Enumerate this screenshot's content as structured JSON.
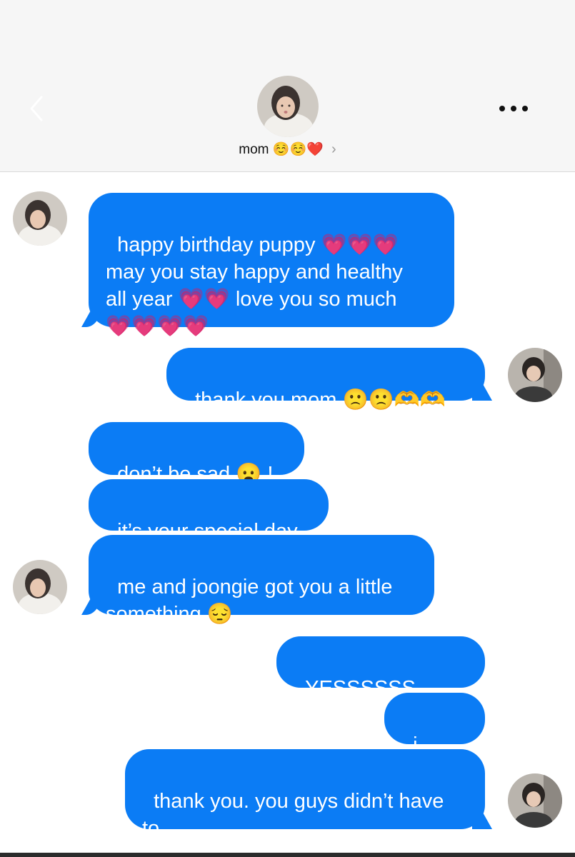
{
  "header": {
    "contact_name": "mom",
    "name_emojis": "☺️☺️❤️",
    "chevron": "›",
    "more": "•••"
  },
  "messages": [
    {
      "side": "left",
      "text": "happy birthday puppy 💗💗💗\nmay you stay happy and healthy\nall year 💗💗 love you so much\n💗💗💗💗"
    },
    {
      "side": "right",
      "text": "thank you mom 🙁🙁🫶🫶"
    },
    {
      "side": "left",
      "text": "don’t be sad 😦 !"
    },
    {
      "side": "left",
      "text": "it’s your special day"
    },
    {
      "side": "left",
      "text": "me and joongie got you a little\nsomething 😔"
    },
    {
      "side": "right",
      "text": "YESSSSSS FUCK"
    },
    {
      "side": "right",
      "text": "i mean"
    },
    {
      "side": "right",
      "text": "thank you. you guys didn’t have\nto."
    }
  ],
  "colors": {
    "bubble": "#0b7cf5",
    "header_bg": "#f6f6f6"
  },
  "icons": {
    "back": "chevron-left-icon",
    "more": "more-dots-icon",
    "avatar": "profile-photo"
  }
}
